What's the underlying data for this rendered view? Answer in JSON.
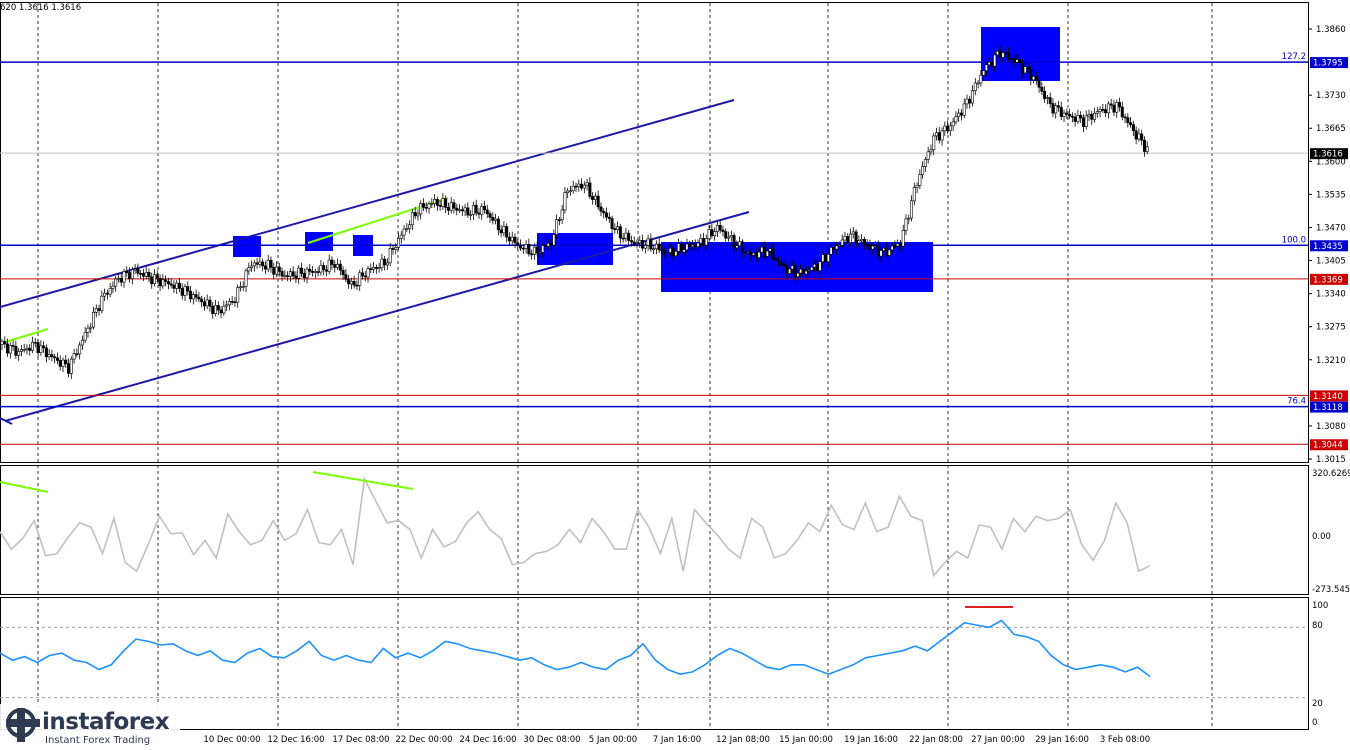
{
  "header": {
    "ohlc_text": "620 1.3616 1.3616"
  },
  "watermark": {
    "name": "instaforex",
    "tagline": "Instant Forex Trading"
  },
  "chart_data": [
    {
      "type": "candlestick",
      "instrument_last": 1.3616,
      "ylim": [
        1.3,
        1.388
      ],
      "y_ticks": [
        1.386,
        1.373,
        1.3665,
        1.36,
        1.3535,
        1.347,
        1.3405,
        1.334,
        1.3275,
        1.321,
        1.308,
        1.3015
      ],
      "x_tick_labels": [
        "10 Dec 00:00",
        "12 Dec 16:00",
        "17 Dec 08:00",
        "22 Dec 00:00",
        "24 Dec 16:00",
        "30 Dec 08:00",
        "5 Jan 00:00",
        "7 Jan 16:00",
        "12 Jan 08:00",
        "15 Jan 00:00",
        "19 Jan 16:00",
        "22 Jan 08:00",
        "27 Jan 00:00",
        "29 Jan 16:00",
        "3 Feb 08:00"
      ],
      "horizontal_levels": [
        {
          "label": "1.3795",
          "fib": "127.2",
          "color": "#0000cc"
        },
        {
          "label": "1.3435",
          "fib": "100.0",
          "color": "#0000cc"
        },
        {
          "label": "1.3369",
          "fib": "",
          "color": "#cc0000"
        },
        {
          "label": "1.3140",
          "fib": "",
          "color": "#cc0000"
        },
        {
          "label": "1.3118",
          "fib": "76.4",
          "color": "#0000cc"
        },
        {
          "label": "1.3044",
          "fib": "",
          "color": "#cc0000"
        }
      ],
      "current_price_label": "1.3616",
      "close_path": [
        1.324,
        1.3225,
        1.324,
        1.3215,
        1.3195,
        1.326,
        1.333,
        1.337,
        1.3385,
        1.337,
        1.336,
        1.3345,
        1.3325,
        1.3305,
        1.333,
        1.34,
        1.3395,
        1.3375,
        1.338,
        1.3385,
        1.34,
        1.3355,
        1.3385,
        1.34,
        1.3455,
        1.3505,
        1.352,
        1.351,
        1.35,
        1.3505,
        1.3465,
        1.3435,
        1.342,
        1.344,
        1.3545,
        1.3555,
        1.3505,
        1.346,
        1.344,
        1.3435,
        1.342,
        1.343,
        1.344,
        1.347,
        1.344,
        1.3415,
        1.3425,
        1.339,
        1.338,
        1.3395,
        1.343,
        1.3455,
        1.3435,
        1.342,
        1.344,
        1.356,
        1.3645,
        1.367,
        1.3715,
        1.378,
        1.3815,
        1.3795,
        1.3765,
        1.371,
        1.369,
        1.368,
        1.37,
        1.371,
        1.366,
        1.3616
      ],
      "channel_lines": "two parallel ascending blue lines",
      "boxes": "blue filled rectangles marking zones"
    },
    {
      "type": "line",
      "name_label": "",
      "ylim_labels": [
        "320.6269",
        "0.00",
        "-273.545"
      ],
      "values": [
        20,
        -60,
        -10,
        70,
        -90,
        -80,
        -5,
        60,
        40,
        -80,
        80,
        -120,
        -160,
        -40,
        90,
        10,
        15,
        -85,
        -20,
        -100,
        100,
        20,
        -40,
        -20,
        70,
        -20,
        10,
        120,
        -30,
        -40,
        30,
        -130,
        260,
        160,
        60,
        70,
        30,
        -100,
        30,
        -50,
        -25,
        60,
        110,
        30,
        -10,
        -130,
        -120,
        -80,
        -70,
        -40,
        30,
        -30,
        80,
        20,
        -60,
        -60,
        120,
        40,
        -80,
        80,
        -160,
        120,
        60,
        5,
        -60,
        -100,
        80,
        40,
        -100,
        -80,
        -20,
        60,
        20,
        140,
        50,
        30,
        150,
        20,
        40,
        180,
        90,
        70,
        -180,
        -120,
        -70,
        -100,
        50,
        40,
        -60,
        80,
        20,
        90,
        70,
        80,
        120,
        -40,
        -110,
        -20,
        150,
        60,
        -160,
        -135
      ]
    },
    {
      "type": "line",
      "ylim_labels": [
        "100",
        "80",
        "20",
        "0"
      ],
      "values": [
        58,
        52,
        55,
        50,
        56,
        58,
        52,
        50,
        44,
        48,
        60,
        70,
        68,
        65,
        66,
        60,
        56,
        60,
        52,
        50,
        58,
        62,
        55,
        54,
        60,
        68,
        56,
        52,
        56,
        52,
        50,
        62,
        54,
        58,
        54,
        60,
        68,
        66,
        62,
        60,
        58,
        55,
        52,
        54,
        48,
        44,
        46,
        50,
        46,
        44,
        52,
        56,
        66,
        52,
        44,
        40,
        42,
        48,
        56,
        62,
        58,
        52,
        46,
        44,
        48,
        48,
        44,
        40,
        44,
        48,
        54,
        56,
        58,
        60,
        64,
        60,
        68,
        76,
        84,
        82,
        80,
        86,
        74,
        72,
        68,
        56,
        48,
        44,
        46,
        48,
        46,
        42,
        46,
        38
      ]
    }
  ]
}
